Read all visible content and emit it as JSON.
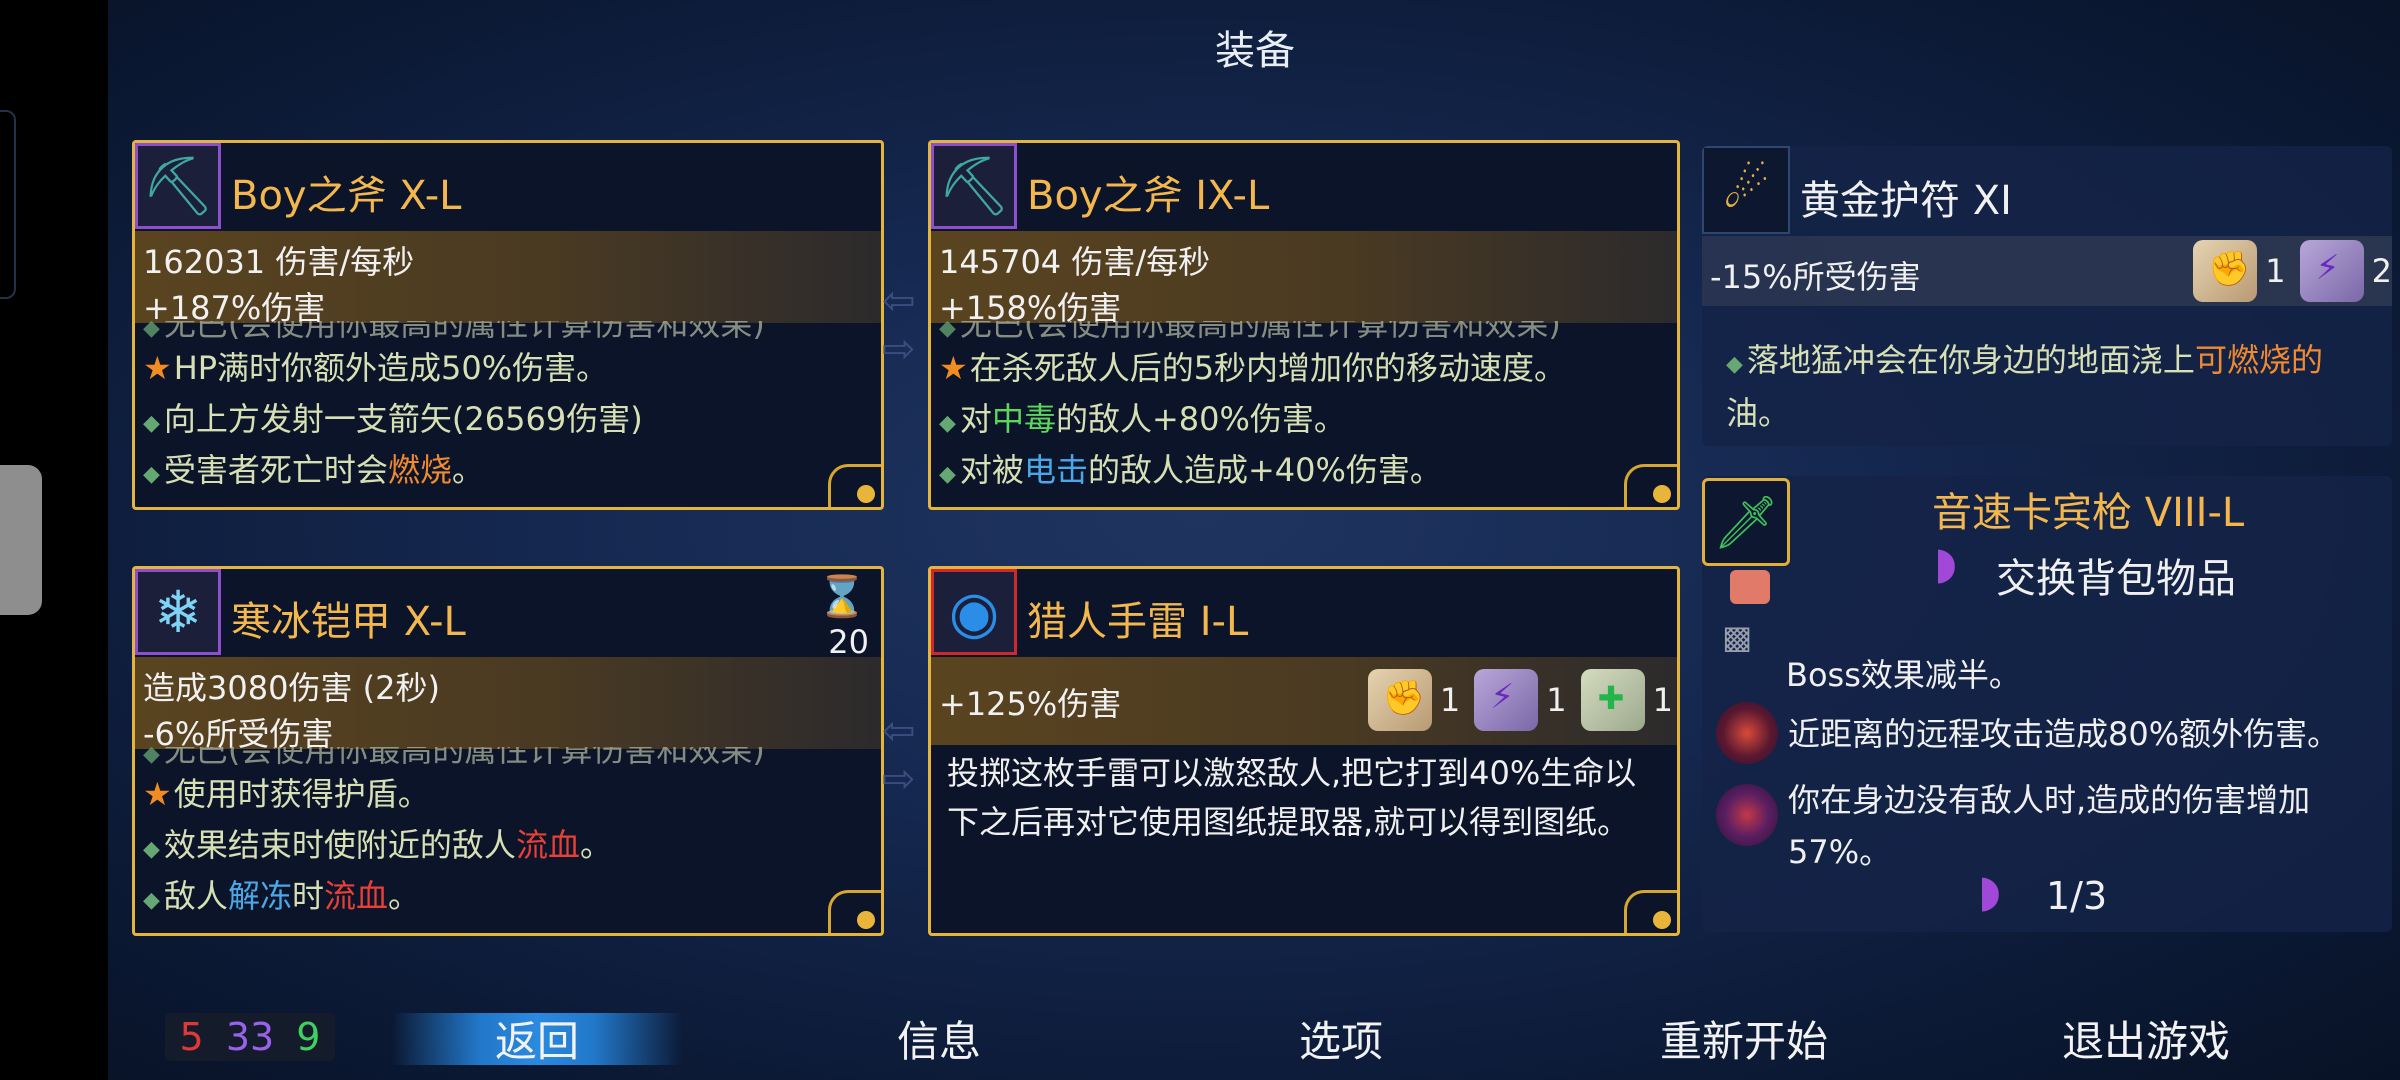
{
  "title": "装备",
  "cards": [
    {
      "name": "Boy之斧 X-L",
      "stat1": "162031 伤害/每秒",
      "stat2": "+187%伤害",
      "cut": "无巴(会使用你最高的属性计算伤害和效果)",
      "eff1": "HP满时你额外造成50%伤害。",
      "eff2": "向上方发射一支箭矢(26569伤害)",
      "eff3a": "受害者死亡时会",
      "eff3b": "燃烧",
      "eff3c": "。"
    },
    {
      "name": "Boy之斧 IX-L",
      "stat1": "145704 伤害/每秒",
      "stat2": "+158%伤害",
      "cut": "无巴(会使用你最高的属性计算伤害和效果)",
      "eff1": "在杀死敌人后的5秒内增加你的移动速度。",
      "eff2a": "对",
      "eff2b": "中毒",
      "eff2c": "的敌人+80%伤害。",
      "eff3a": "对被",
      "eff3b": "电击",
      "eff3c": "的敌人造成+40%伤害。"
    },
    {
      "name": "寒冰铠甲 X-L",
      "timer": "20",
      "stat1": "造成3080伤害 (2秒)",
      "stat2": "-6%所受伤害",
      "cut": "无巴(会使用你最高的属性计算伤害和效果)",
      "eff1": "使用时获得护盾。",
      "eff2a": "效果结束时使附近的敌人",
      "eff2b": "流血",
      "eff2c": "。",
      "eff3a": "敌人",
      "eff3b": "解冻",
      "eff3c": "时",
      "eff3d": "流血",
      "eff3e": "。"
    },
    {
      "name": "猎人手雷 I-L",
      "stat1": "+125%伤害",
      "scrolls": [
        "1",
        "1",
        "1"
      ],
      "desc": "投掷这枚手雷可以激怒敌人,把它打到40%生命以下之后再对它使用图纸提取器,就可以得到图纸。"
    }
  ],
  "amulet": {
    "name": "黄金护符 XI",
    "stat": "-15%所受伤害",
    "scroll_red": "1",
    "scroll_pur": "2",
    "desc_a": "落地猛冲会在你身边的地面浇上",
    "desc_b": "可燃烧的",
    "desc_c": "油。"
  },
  "weapon": {
    "name": "音速卡宾枪 VIII-L",
    "swap": "交换背包物品",
    "cut": "Boss效果减半。",
    "eff1": "近距离的远程攻击造成80%额外伤害。",
    "eff2": "你在身边没有敌人时,造成的伤害增加57%。",
    "backpack": "1/3"
  },
  "scores": {
    "red": "5",
    "purple": "33",
    "green": "9"
  },
  "menu": {
    "back": "返回",
    "info": "信息",
    "options": "选项",
    "restart": "重新开始",
    "quit": "退出游戏"
  },
  "colors": {
    "gold": "#e4b53c",
    "name": "#f3b74e",
    "burn": "#f08a30",
    "bleed": "#e84036",
    "poison": "#5ad85e",
    "shock": "#4aa8e8"
  }
}
